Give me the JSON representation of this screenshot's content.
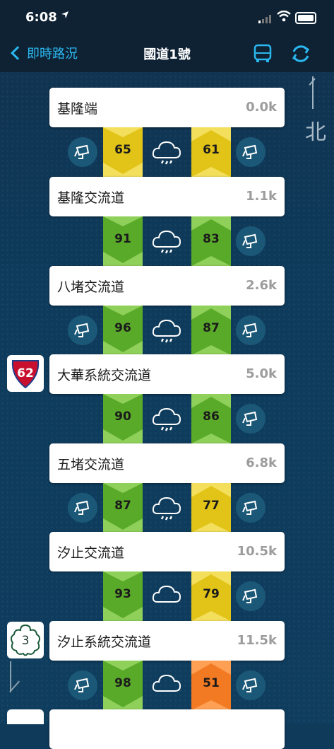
{
  "status_bar": {
    "time": "6:08",
    "location_icon": "location-arrow-icon"
  },
  "nav": {
    "back_label": "即時路況",
    "title": "國道1號"
  },
  "compass": {
    "north_label": "北"
  },
  "colors": {
    "green": "#5aaa2a",
    "yellow": "#e2c418",
    "orange": "#f27a22",
    "accent": "#2bb8f0"
  },
  "stations": [
    {
      "name": "基隆端",
      "km": "0.0k"
    },
    {
      "name": "基隆交流道",
      "km": "1.1k"
    },
    {
      "name": "八堵交流道",
      "km": "2.6k"
    },
    {
      "name": "大華系統交流道",
      "km": "5.0k",
      "badge": "62"
    },
    {
      "name": "五堵交流道",
      "km": "6.8k"
    },
    {
      "name": "汐止交流道",
      "km": "10.5k"
    },
    {
      "name": "汐止系統交流道",
      "km": "11.5k",
      "badge": "3"
    }
  ],
  "segments": [
    {
      "south": "65",
      "south_color": "yellow",
      "north": "61",
      "north_color": "yellow",
      "rain": true,
      "cam_left": true
    },
    {
      "south": "91",
      "south_color": "green",
      "north": "83",
      "north_color": "green",
      "rain": true,
      "cam_left": false
    },
    {
      "south": "96",
      "south_color": "green",
      "north": "87",
      "north_color": "green",
      "rain": true,
      "cam_left": true
    },
    {
      "south": "90",
      "south_color": "green",
      "north": "86",
      "north_color": "green",
      "rain": true,
      "cam_left": false
    },
    {
      "south": "87",
      "south_color": "green",
      "north": "77",
      "north_color": "yellow",
      "rain": true,
      "cam_left": true
    },
    {
      "south": "93",
      "south_color": "green",
      "north": "79",
      "north_color": "yellow",
      "rain": false,
      "cam_left": false
    },
    {
      "south": "98",
      "south_color": "green",
      "north": "51",
      "north_color": "orange",
      "rain": false,
      "cam_left": true
    }
  ]
}
